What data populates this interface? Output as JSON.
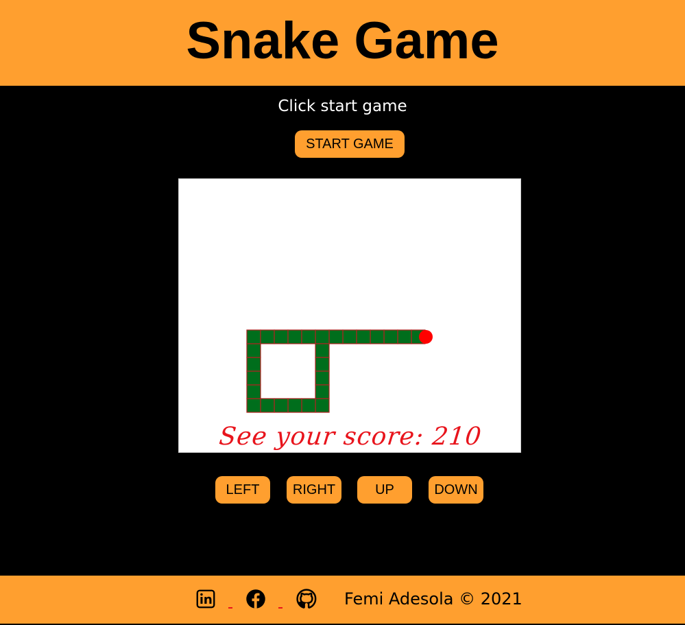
{
  "header": {
    "title": "Snake Game"
  },
  "instruction": "Click start game",
  "buttons": {
    "start": "START GAME",
    "left": "LEFT",
    "right": "RIGHT",
    "up": "UP",
    "down": "DOWN"
  },
  "game": {
    "score_label": "See your score: 210",
    "snake_color": "#006E1C",
    "snake_border": "#B22222",
    "food_color": "#FF0000",
    "snake_cells": [
      [
        12,
        0
      ],
      [
        11,
        0
      ],
      [
        10,
        0
      ],
      [
        9,
        0
      ],
      [
        8,
        0
      ],
      [
        7,
        0
      ],
      [
        6,
        0
      ],
      [
        5,
        0
      ],
      [
        5,
        1
      ],
      [
        5,
        2
      ],
      [
        5,
        3
      ],
      [
        5,
        4
      ],
      [
        5,
        5
      ],
      [
        4,
        5
      ],
      [
        3,
        5
      ],
      [
        2,
        5
      ],
      [
        1,
        5
      ],
      [
        0,
        5
      ],
      [
        0,
        4
      ],
      [
        0,
        3
      ],
      [
        0,
        2
      ],
      [
        0,
        1
      ],
      [
        0,
        0
      ],
      [
        1,
        0
      ],
      [
        2,
        0
      ],
      [
        3,
        0
      ],
      [
        4,
        0
      ]
    ],
    "food_cell": [
      13,
      0
    ]
  },
  "footer": {
    "icons": [
      "linkedin-icon",
      "facebook-icon",
      "github-icon"
    ],
    "copyright": "Femi Adesola © 2021"
  },
  "colors": {
    "accent": "#FF9F2F",
    "background": "#000000",
    "score_text": "#E8141C"
  }
}
